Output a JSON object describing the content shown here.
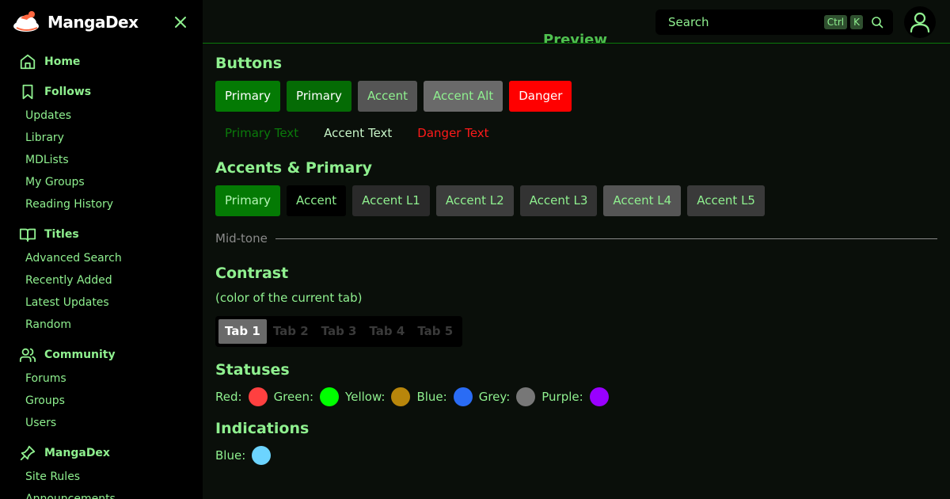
{
  "brand": {
    "name": "MangaDex"
  },
  "sidebar": {
    "sections": [
      {
        "label": "Home",
        "icon": "home-icon",
        "items": []
      },
      {
        "label": "Follows",
        "icon": "bookmark-icon",
        "items": [
          "Updates",
          "Library",
          "MDLists",
          "My Groups",
          "Reading History"
        ]
      },
      {
        "label": "Titles",
        "icon": "book-open-icon",
        "items": [
          "Advanced Search",
          "Recently Added",
          "Latest Updates",
          "Random"
        ]
      },
      {
        "label": "Community",
        "icon": "users-icon",
        "items": [
          "Forums",
          "Groups",
          "Users"
        ]
      },
      {
        "label": "MangaDex",
        "icon": "pin-icon",
        "items": [
          "Site Rules",
          "Announcements"
        ]
      }
    ]
  },
  "topbar": {
    "search_label": "Search",
    "kbd_ctrl": "Ctrl",
    "kbd_k": "K",
    "clipped_heading": "Preview"
  },
  "main": {
    "buttons_title": "Buttons",
    "buttons": [
      "Primary",
      "Primary",
      "Accent",
      "Accent Alt",
      "Danger"
    ],
    "text_buttons": [
      "Primary Text",
      "Accent Text",
      "Danger Text"
    ],
    "accents_title": "Accents & Primary",
    "accents": [
      "Primary",
      "Accent",
      "Accent L1",
      "Accent L2",
      "Accent L3",
      "Accent L4",
      "Accent L5"
    ],
    "midtone_label": "Mid-tone",
    "contrast_title": "Contrast",
    "contrast_sub": "(color of the current tab)",
    "tabs": [
      "Tab 1",
      "Tab 2",
      "Tab 3",
      "Tab 4",
      "Tab 5"
    ],
    "statuses_title": "Statuses",
    "statuses": [
      {
        "label": "Red:",
        "color": "#ff4040"
      },
      {
        "label": "Green:",
        "color": "#00ff00"
      },
      {
        "label": "Yellow:",
        "color": "#b8860b"
      },
      {
        "label": "Blue:",
        "color": "#2a6cf5"
      },
      {
        "label": "Grey:",
        "color": "#777777"
      },
      {
        "label": "Purple:",
        "color": "#9900ff"
      }
    ],
    "indications_title": "Indications",
    "indications": [
      {
        "label": "Blue:",
        "color": "#6cd4ff"
      }
    ]
  }
}
